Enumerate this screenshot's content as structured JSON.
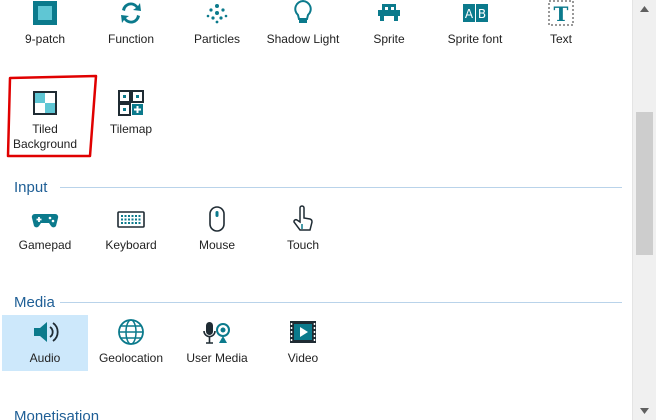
{
  "row1": [
    "9-patch",
    "Function",
    "Particles",
    "Shadow Light",
    "Sprite",
    "Sprite font",
    "Text"
  ],
  "row2": [
    "Tiled Background",
    "Tilemap"
  ],
  "sections": {
    "input": {
      "title": "Input",
      "items": [
        "Gamepad",
        "Keyboard",
        "Mouse",
        "Touch"
      ]
    },
    "media": {
      "title": "Media",
      "items": [
        "Audio",
        "Geolocation",
        "User Media",
        "Video"
      ]
    },
    "monetisation": {
      "title": "Monetisation"
    }
  },
  "selected_item": "Audio",
  "colors": {
    "accent": "#1f5f96",
    "icon": "#0b7a8c",
    "selected_bg": "#cde8fb",
    "annotation": "#e00000"
  },
  "icons": [
    "nine-patch-icon",
    "function-icon",
    "particles-icon",
    "shadow-light-icon",
    "sprite-icon",
    "sprite-font-icon",
    "text-icon",
    "tiled-background-icon",
    "tilemap-icon",
    "gamepad-icon",
    "keyboard-icon",
    "mouse-icon",
    "touch-icon",
    "audio-icon",
    "geolocation-icon",
    "user-media-icon",
    "video-icon"
  ]
}
